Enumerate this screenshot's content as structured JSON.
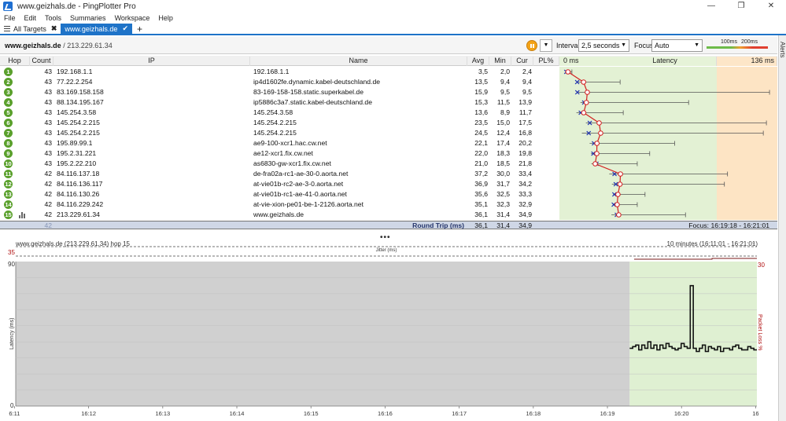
{
  "window": {
    "title": "www.geizhals.de - PingPlotter Pro",
    "controls": [
      "—",
      "❐",
      "✕"
    ]
  },
  "menu": [
    "File",
    "Edit",
    "Tools",
    "Summaries",
    "Workspace",
    "Help"
  ],
  "tabs": {
    "all_label": "All Targets",
    "active_label": "www.geizhals.de"
  },
  "alerts_label": "Alerts",
  "toolbar": {
    "target_host": "www.geizhals.de",
    "target_ip": " / 213.229.61.34",
    "interval_label": "Interval",
    "interval_value": "2,5 seconds",
    "focus_label": "Focus",
    "focus_value": "Auto",
    "scale_100": "100ms",
    "scale_200": "200ms"
  },
  "columns": {
    "hop": "Hop",
    "count": "Count",
    "ip": "IP",
    "name": "Name",
    "avg": "Avg",
    "min": "Min",
    "cur": "Cur",
    "pl": "PL%",
    "latency": "Latency",
    "lat_min": "0 ms",
    "lat_max": "136 ms"
  },
  "lat_max_ms": 136,
  "hops": [
    {
      "hop": "1",
      "count": "43",
      "ip": "192.168.1.1",
      "name": "192.168.1.1",
      "avg": "3,5",
      "min": "2,0",
      "cur": "2,4",
      "max_ms": 6
    },
    {
      "hop": "2",
      "count": "43",
      "ip": "77.22.2.254",
      "name": "ip4d1602fe.dynamic.kabel-deutschland.de",
      "avg": "13,5",
      "min": "9,4",
      "cur": "9,4",
      "max_ms": 37
    },
    {
      "hop": "3",
      "count": "43",
      "ip": "83.169.158.158",
      "name": "83-169-158-158.static.superkabel.de",
      "avg": "15,9",
      "min": "9,5",
      "cur": "9,5",
      "max_ms": 133
    },
    {
      "hop": "4",
      "count": "43",
      "ip": "88.134.195.167",
      "name": "ip5886c3a7.static.kabel-deutschland.de",
      "avg": "15,3",
      "min": "11,5",
      "cur": "13,9",
      "max_ms": 81
    },
    {
      "hop": "5",
      "count": "43",
      "ip": "145.254.3.58",
      "name": "145.254.3.58",
      "avg": "13,6",
      "min": "8,9",
      "cur": "11,7",
      "max_ms": 39
    },
    {
      "hop": "6",
      "count": "43",
      "ip": "145.254.2.215",
      "name": "145.254.2.215",
      "avg": "23,5",
      "min": "15,0",
      "cur": "17,5",
      "max_ms": 131
    },
    {
      "hop": "7",
      "count": "43",
      "ip": "145.254.2.215",
      "name": "145.254.2.215",
      "avg": "24,5",
      "min": "12,4",
      "cur": "16,8",
      "max_ms": 129
    },
    {
      "hop": "8",
      "count": "43",
      "ip": "195.89.99.1",
      "name": "ae9-100-xcr1.hac.cw.net",
      "avg": "22,1",
      "min": "17,4",
      "cur": "20,2",
      "max_ms": 72
    },
    {
      "hop": "9",
      "count": "43",
      "ip": "195.2.31.221",
      "name": "ae12-xcr1.fix.cw.net",
      "avg": "22,0",
      "min": "18,3",
      "cur": "19,8",
      "max_ms": 56
    },
    {
      "hop": "10",
      "count": "43",
      "ip": "195.2.22.210",
      "name": "as6830-gw-xcr1.fix.cw.net",
      "avg": "21,0",
      "min": "18,5",
      "cur": "21,8",
      "max_ms": 48
    },
    {
      "hop": "11",
      "count": "42",
      "ip": "84.116.137.18",
      "name": "de-fra02a-rc1-ae-30-0.aorta.net",
      "avg": "37,2",
      "min": "30,0",
      "cur": "33,4",
      "max_ms": 106
    },
    {
      "hop": "12",
      "count": "42",
      "ip": "84.116.136.117",
      "name": "at-vie01b-rc2-ae-3-0.aorta.net",
      "avg": "36,9",
      "min": "31,7",
      "cur": "34,2",
      "max_ms": 104
    },
    {
      "hop": "13",
      "count": "42",
      "ip": "84.116.130.26",
      "name": "at-vie01b-rc1-ae-41-0.aorta.net",
      "avg": "35,6",
      "min": "32,5",
      "cur": "33,3",
      "max_ms": 53
    },
    {
      "hop": "14",
      "count": "42",
      "ip": "84.116.229.242",
      "name": "at-vie-xion-pe01-be-1-2126.aorta.net",
      "avg": "35,1",
      "min": "32,3",
      "cur": "32,9",
      "max_ms": 48
    },
    {
      "hop": "15",
      "count": "42",
      "ip": "213.229.61.34",
      "name": "www.geizhals.de",
      "avg": "36,1",
      "min": "31,4",
      "cur": "34,9",
      "max_ms": 79
    }
  ],
  "round_trip": {
    "count": "42",
    "label": "Round Trip (ms)",
    "avg": "36,1",
    "min": "31,4",
    "cur": "34,9",
    "focus": "Focus: 16:19:18 - 16:21:01"
  },
  "chart": {
    "title": "www.geizhals.de (213.229.61.34) hop 15",
    "range": "10 minutes (16:11:01 - 16:21:01)",
    "jitter_label": "Jitter (ms)",
    "jitter_max": "35",
    "y_max": "90",
    "y_min": "0",
    "ylabel": "Latency (ms)",
    "pl_label": "Packet Loss %",
    "pl_max": "30",
    "x_ticks": [
      "6:11",
      "16:12",
      "16:13",
      "16:14",
      "16:15",
      "16:16",
      "16:17",
      "16:18",
      "16:19",
      "16:20",
      "16"
    ]
  },
  "chart_data": {
    "type": "line",
    "title": "www.geizhals.de (213.229.61.34) hop 15",
    "xlabel": "",
    "ylabel": "Latency (ms)",
    "ylim": [
      0,
      90
    ],
    "x_range": [
      "16:11:01",
      "16:21:01"
    ],
    "focus_range": [
      "16:19:18",
      "16:21:01"
    ],
    "series": [
      {
        "values": [
          36,
          37,
          38,
          35,
          38,
          36,
          40,
          36,
          38,
          35,
          38,
          36,
          39,
          37,
          36,
          35,
          36,
          39,
          37,
          36,
          75,
          36,
          34,
          36,
          38,
          34,
          37,
          36,
          35,
          37,
          34,
          36,
          36,
          35,
          37,
          38,
          36,
          35,
          35,
          37,
          36,
          35
        ]
      }
    ]
  }
}
